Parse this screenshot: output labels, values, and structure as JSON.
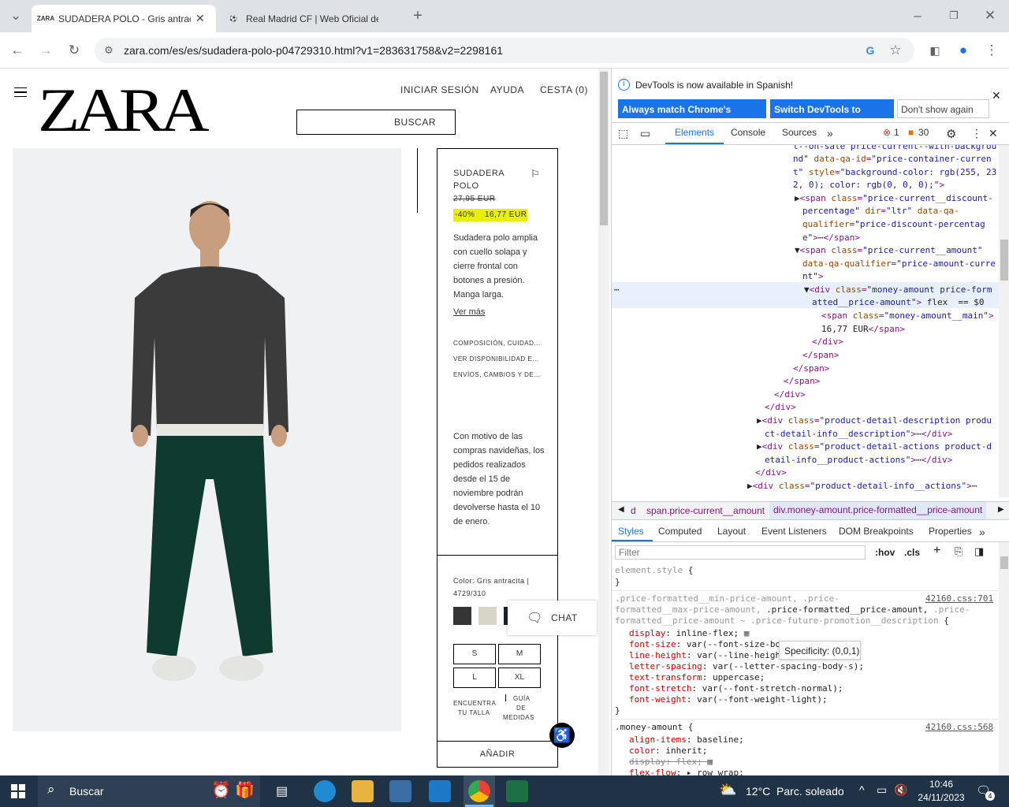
{
  "browser": {
    "tabs": [
      {
        "favicon": "ZARA",
        "title": "SUDADERA POLO - Gris antracita",
        "active": true
      },
      {
        "favicon": "real-madrid-crest",
        "title": "Real Madrid CF | Web Oficial de",
        "active": false
      }
    ],
    "url": "zara.com/es/es/sudadera-polo-p04729310.html?v1=283631758&v2=2298161"
  },
  "zara": {
    "logo": "ZARA",
    "nav": {
      "login": "INICIAR SESIÓN",
      "help": "AYUDA",
      "cart": "CESTA (0)"
    },
    "search_label": "BUSCAR",
    "product": {
      "name_line1": "SUDADERA",
      "name_line2": "POLO",
      "old_price": "27,95 EUR",
      "discount": "-40%",
      "price": "16,77 EUR",
      "description": "Sudadera polo amplia con cuello solapa y cierre frontal con botones a presión. Manga larga.",
      "see_more": "Ver más",
      "links": [
        "COMPOSICIÓN, CUIDAD...",
        "VER DISPONIBILIDAD E...",
        "ENVÍOS, CAMBIOS Y DE..."
      ],
      "notice": "Con motivo de las compras navideñas, los pedidos realizados desde el 15 de noviembre podrán devolverse hasta el 10 de enero.",
      "color_line1": "Color: Gris antracita |",
      "color_line2": "4729/310",
      "sizes": [
        "S",
        "M",
        "L",
        "XL"
      ],
      "find_size_1": "ENCUENTRA",
      "find_size_2": "TU TALLA",
      "guide_1": "GUÍA",
      "guide_2": "DE",
      "guide_3": "MEDIDAS",
      "add": "AÑADIR"
    },
    "chat": "CHAT"
  },
  "devtools": {
    "banner": "DevTools is now available in Spanish!",
    "btn_match": "Always match Chrome's language",
    "btn_switch": "Switch DevTools to Spanish",
    "btn_dont": "Don't show again",
    "tabs": [
      "Elements",
      "Console",
      "Sources"
    ],
    "errors": "1",
    "warnings": "30",
    "breadcrumbs": [
      "d",
      "span.price-current__amount",
      "div.money-amount.price-formatted__price-amount"
    ],
    "style_tabs": [
      "Styles",
      "Computed",
      "Layout",
      "Event Listeners",
      "DOM Breakpoints",
      "Properties"
    ],
    "filter_placeholder": "Filter",
    "hov": ":hov",
    "cls": ".cls",
    "tooltip": "Specificity: (0,0,1)",
    "source1": "42160.css:701",
    "source2": "42160.css:568"
  },
  "taskbar": {
    "search": "Buscar",
    "weather": "12°C  Parc. soleado",
    "time": "10:46",
    "date": "24/11/2023",
    "notifications": "4"
  }
}
